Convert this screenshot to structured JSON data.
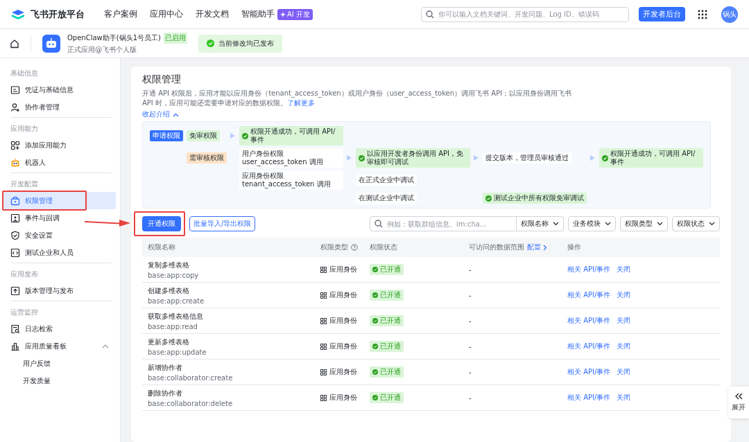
{
  "topbar": {
    "brand": "飞书开放平台",
    "nav": [
      {
        "label": "客户案例"
      },
      {
        "label": "应用中心"
      },
      {
        "label": "开发文档"
      },
      {
        "label": "智能助手",
        "badge": "AI 开发"
      }
    ],
    "search": {
      "placeholder": "你可以输入文档关键词、开发问题、Log ID、错误码"
    },
    "console_button": "开发者后台",
    "avatar": "锅头"
  },
  "app_bar": {
    "name": "OpenClaw助手(锅头1号员工)",
    "status_badge": "已启用",
    "subtitle": "正式应用@飞书个人版",
    "notice": "当前修改均已发布"
  },
  "sidebar": {
    "sections": [
      {
        "title": "基础信息",
        "items": [
          {
            "label": "凭证与基础信息",
            "selected": false
          },
          {
            "label": "协作者管理",
            "selected": false
          }
        ]
      },
      {
        "title": "应用能力",
        "items": [
          {
            "label": "添加应用能力",
            "selected": false
          },
          {
            "label": "机器人",
            "selected": false
          }
        ]
      },
      {
        "title": "开发配置",
        "items": [
          {
            "label": "权限管理",
            "selected": true,
            "highlighted": true
          },
          {
            "label": "事件与回调",
            "selected": false
          },
          {
            "label": "安全设置",
            "selected": false
          },
          {
            "label": "测试企业和人员",
            "selected": false
          }
        ]
      },
      {
        "title": "应用发布",
        "items": [
          {
            "label": "版本管理与发布",
            "selected": false
          }
        ]
      },
      {
        "title": "运营监控",
        "items": [
          {
            "label": "日志检索",
            "selected": false
          },
          {
            "label": "应用质量看板",
            "selected": false,
            "expanded": true,
            "children": [
              {
                "label": "用户反馈",
                "selected": false
              },
              {
                "label": "开发质量",
                "selected": false
              }
            ]
          }
        ]
      }
    ]
  },
  "page": {
    "title": "权限管理",
    "description": "开通 API 权限后，应用才能以应用身份（tenant_access_token）或用户身份（user_access_token）调用飞书 API；以应用身份调用飞书 API 时，应用可能还需要申请对应的数据权限。",
    "learn_more": "了解更多",
    "collapse_link": "收起介绍",
    "flow": [
      {
        "kind": "start",
        "text": "申请权限"
      },
      {
        "kind": "free",
        "text": "免审权限"
      },
      {
        "kind": "success",
        "text": "权限开通成功，可调用 API/事件"
      },
      {
        "kind": "review",
        "text": "需审核权限"
      },
      {
        "kind": "step",
        "text": "用户身份权限 user_access_token 调用"
      },
      {
        "kind": "success",
        "text": "以应用开发者身份调用 API，免审核即可调试"
      },
      {
        "kind": "step",
        "text": "提交版本，管理员审核通过"
      },
      {
        "kind": "success",
        "text": "权限开通成功，可调用 API/事件"
      },
      {
        "kind": "step",
        "text": "应用身份权限 tenant_access_token 调用"
      },
      {
        "kind": "step",
        "text": "在正式企业中调试"
      },
      {
        "kind": "step",
        "text": "在测试企业中调试"
      },
      {
        "kind": "success",
        "text": "测试企业中所有权限免审调试"
      }
    ],
    "primary_button": {
      "label": "开通权限",
      "highlighted": true
    },
    "secondary_button": "批量导入/导出权限",
    "filter_search": {
      "placeholder": "例如：获取群组信息、im:cha...",
      "field": "权限名称"
    },
    "filters": [
      "业务模块",
      "权限类型",
      "权限状态"
    ],
    "table": {
      "columns": [
        {
          "label": "权限名称"
        },
        {
          "label": "权限类型",
          "help": true
        },
        {
          "label": "权限状态"
        },
        {
          "label": "可访问的数据范围",
          "link": "配置"
        },
        {
          "label": "操作"
        }
      ],
      "rows": [
        {
          "name": "复制多维表格",
          "scope": "base:app:copy",
          "type": "应用身份",
          "status": "已开通",
          "data_range": "-",
          "actions": [
            "相关 API/事件",
            "关闭"
          ]
        },
        {
          "name": "创建多维表格",
          "scope": "base:app:create",
          "type": "应用身份",
          "status": "已开通",
          "data_range": "-",
          "actions": [
            "相关 API/事件",
            "关闭"
          ]
        },
        {
          "name": "获取多维表格信息",
          "scope": "base:app:read",
          "type": "应用身份",
          "status": "已开通",
          "data_range": "-",
          "actions": [
            "相关 API/事件",
            "关闭"
          ]
        },
        {
          "name": "更新多维表格",
          "scope": "base:app:update",
          "type": "应用身份",
          "status": "已开通",
          "data_range": "-",
          "actions": [
            "相关 API/事件",
            "关闭"
          ]
        },
        {
          "name": "新增协作者",
          "scope": "base:collaborator:create",
          "type": "应用身份",
          "status": "已开通",
          "data_range": "-",
          "actions": [
            "相关 API/事件",
            "关闭"
          ]
        },
        {
          "name": "删除协作者",
          "scope": "base:collaborator:delete",
          "type": "应用身份",
          "status": "已开通",
          "data_range": "-",
          "actions": [
            "相关 API/事件",
            "关闭"
          ]
        }
      ]
    }
  },
  "annotation_arrow": true,
  "side_tab": {
    "label": "展开"
  }
}
